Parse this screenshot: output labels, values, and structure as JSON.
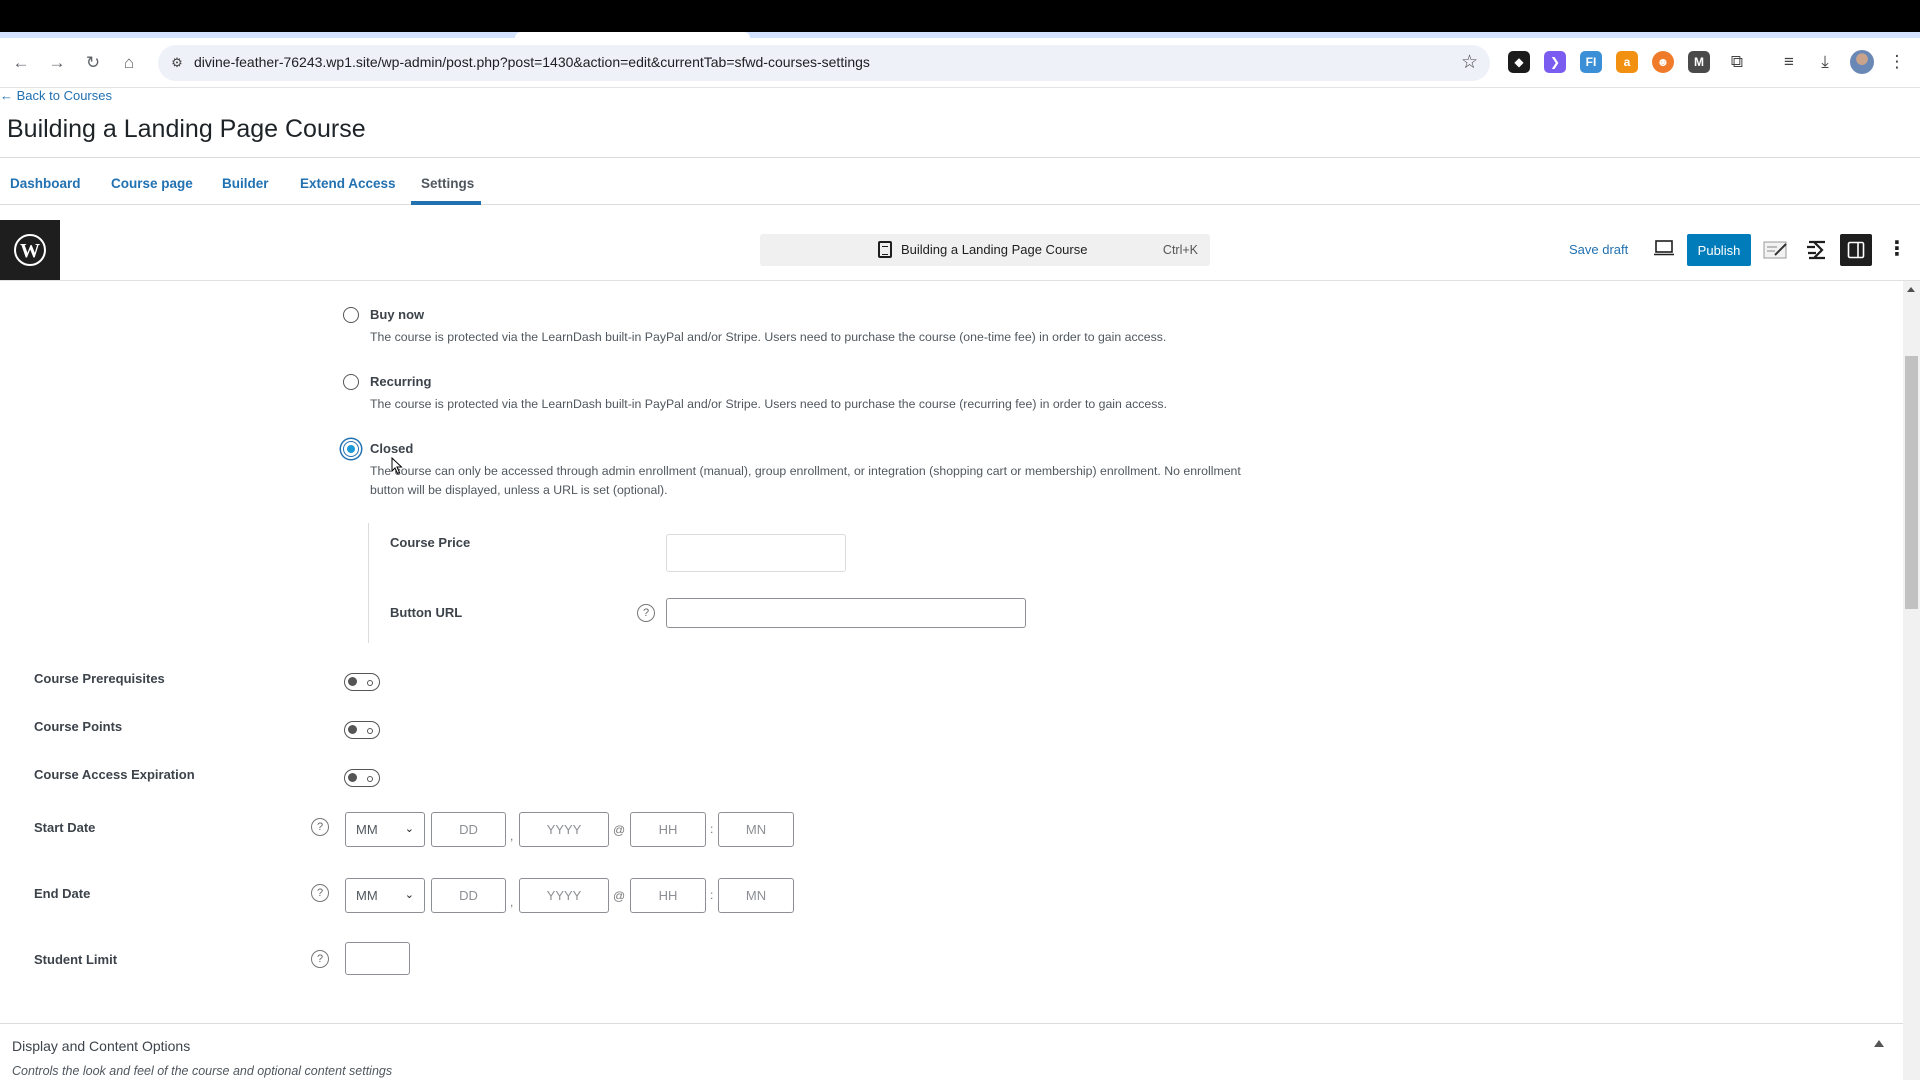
{
  "browser": {
    "url": "divine-feather-76243.wp1.site/wp-admin/post.php?post=1430&action=edit&currentTab=sfwd-courses-settings",
    "extensions": [
      {
        "name": "cursor-extension-icon",
        "color": "#1b1b1b",
        "glyph": "◆"
      },
      {
        "name": "purple-extension-icon",
        "color": "#7b5cf0",
        "glyph": "❯"
      },
      {
        "name": "fi-extension-icon",
        "color": "#3a8fd6",
        "glyph": "FI"
      },
      {
        "name": "amazon-extension-icon",
        "color": "#f29111",
        "glyph": "a"
      },
      {
        "name": "robot-extension-icon",
        "color": "#f07c2b",
        "glyph": "☻"
      },
      {
        "name": "m-extension-icon",
        "color": "#4a4a4a",
        "glyph": "M"
      }
    ]
  },
  "learndash": {
    "back_link": "← Back to Courses",
    "title": "Building a Landing Page Course",
    "tabs": [
      {
        "label": "Dashboard",
        "active": false
      },
      {
        "label": "Course page",
        "active": false
      },
      {
        "label": "Builder",
        "active": false
      },
      {
        "label": "Extend Access",
        "active": false
      },
      {
        "label": "Settings",
        "active": true
      }
    ]
  },
  "editor": {
    "document_title": "Building a Landing Page Course",
    "shortcut": "Ctrl+K",
    "save_draft": "Save draft",
    "publish": "Publish",
    "accent": "#007cba"
  },
  "access_modes": [
    {
      "label": "Buy now",
      "description": "The course is protected via the LearnDash built-in PayPal and/or Stripe. Users need to purchase the course (one-time fee) in order to gain access.",
      "checked": false
    },
    {
      "label": "Recurring",
      "description": "The course is protected via the LearnDash built-in PayPal and/or Stripe. Users need to purchase the course (recurring fee) in order to gain access.",
      "checked": false
    },
    {
      "label": "Closed",
      "description": "The course can only be accessed through admin enrollment (manual), group enrollment, or integration (shopping cart or membership) enrollment. No enrollment button will be displayed, unless a URL is set (optional).",
      "checked": true
    }
  ],
  "closed_fields": {
    "course_price_label": "Course Price",
    "course_price_value": "",
    "button_url_label": "Button URL",
    "button_url_value": ""
  },
  "toggles": [
    {
      "label": "Course Prerequisites",
      "on": false
    },
    {
      "label": "Course Points",
      "on": false
    },
    {
      "label": "Course Access Expiration",
      "on": false
    }
  ],
  "dates": {
    "start_label": "Start Date",
    "end_label": "End Date",
    "placeholders": {
      "month": "MM",
      "day": "DD",
      "year": "YYYY",
      "hour": "HH",
      "minute": "MN"
    },
    "sep_comma": ",",
    "sep_at": "@",
    "sep_colon": ":"
  },
  "student_limit": {
    "label": "Student Limit",
    "value": ""
  },
  "help_glyph": "?",
  "display_section": {
    "title": "Display and Content Options",
    "description": "Controls the look and feel of the course and optional content settings"
  }
}
